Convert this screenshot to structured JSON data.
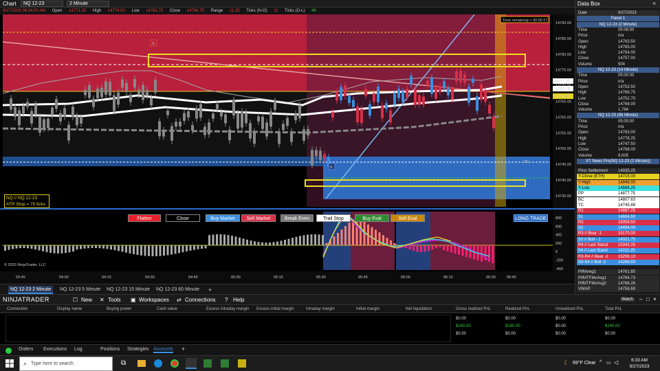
{
  "window": {
    "title": "Chart",
    "instrument": "NQ 12-23",
    "interval": "2 Minute"
  },
  "infobar": {
    "date": "9/27/2023 06:34:00 AM",
    "open_label": "Open",
    "open": "14771.25",
    "high_label": "High",
    "high": "14774.00",
    "low_label": "Low",
    "low": "14762.75",
    "close_label": "Close",
    "close": "14766.75",
    "range_label": "Range",
    "range": "11.25",
    "ticks_nd_label": "Ticks (N-O)",
    "ticks_nd": "11",
    "ticks_ol_label": "Ticks (O-L)",
    "ticks_ol": "46"
  },
  "chart_title": "NQ 12-23 (2 Minute), NQ 12-23 (14 Minute), NQ 12-23 (56 Minute)XT News Pro(NQ 12-23 (2 Minute))",
  "time_remaining": "Time remaining = 00:00:27",
  "price_axis": [
    "14790.00",
    "14785.00",
    "14780.00",
    "14775.00",
    "14770.00",
    "14765.00",
    "14760.00",
    "14755.00",
    "14750.00",
    "14745.00",
    "14740.00",
    "14735.00"
  ],
  "price_flags": [
    {
      "text": "14771.31"
    },
    {
      "text": "14768.78"
    },
    {
      "text": "14766.75"
    }
  ],
  "indicator_axis": [
    "800",
    "600",
    "400",
    "200",
    "0",
    "-200",
    "-400",
    "-600"
  ],
  "time_axis": [
    "03:45",
    "04:00",
    "04:15",
    "04:30",
    "04:45",
    "05:00",
    "05:15",
    "05:30",
    "05:45",
    "06:00",
    "06:15",
    "06:30",
    "06:45"
  ],
  "markers": {
    "s": "S",
    "b": "B",
    "tc": "TC"
  },
  "position_box": {
    "line1": "NQ // NQ 12-23",
    "line2": "ATR Stop = 70 ticks"
  },
  "copyright": "© 2023 NinjaTrader, LLC",
  "buttons": [
    {
      "label": "Flatten",
      "color": "#e8202a"
    },
    {
      "label": "Close",
      "color": "#000000"
    },
    {
      "label": "Buy Market",
      "color": "#3b8fe0"
    },
    {
      "label": "Sell Market",
      "color": "#d83048"
    },
    {
      "label": "Break Even",
      "color": "#777777"
    },
    {
      "label": "Trail Stop",
      "color": "#ffffff"
    },
    {
      "label": "Buy Eval",
      "color": "#2e8b2e"
    },
    {
      "label": "Sell Eval",
      "color": "#c8880a"
    }
  ],
  "long_trade": "LONG TRADE",
  "chart_tabs": [
    "NQ 12-23 2 Minute",
    "NQ 12-23 5 Minute",
    "NQ 12-23 15 Minute",
    "NQ 12-23 60 Minute",
    "+"
  ],
  "control_center": {
    "brand": "NINJATRADER",
    "menus": [
      "New",
      "Tools",
      "Workspaces",
      "Connections",
      "Help"
    ],
    "watch": "Watch"
  },
  "accounts": {
    "headers": [
      "Connection",
      "Display name",
      "Buying power",
      "Cash value",
      "Excess intraday margin",
      "Excess initial margin",
      "Intraday margin",
      "Initial margin",
      "Net liquidation",
      "Gross realized PnL",
      "Realized PnL",
      "Unrealized PnL",
      "Total PnL"
    ],
    "rows": [
      [
        "$0.00",
        "$0.00",
        "$0.00",
        "$0.00"
      ],
      [
        "$240.00",
        "$240.00",
        "$0.00",
        "$240.00"
      ],
      [
        "$0.00",
        "$0.00",
        "$0.00",
        "$0.00"
      ]
    ]
  },
  "bottom_tabs": [
    "Orders",
    "Executions",
    "Log",
    "Positions",
    "Strategies",
    "Accounts",
    "+"
  ],
  "taskbar": {
    "search": "Type here to search",
    "weather": "69°F  Clear",
    "time": "6:33 AM",
    "date": "9/27/2023"
  },
  "databox": {
    "title": "Data Box",
    "date_label": "Date",
    "date": "9/27/2023",
    "panel": "Panel 1",
    "sections": [
      {
        "header": "NQ 12-23 (2 Minute)",
        "rows": [
          [
            "Time",
            "05:06:00"
          ],
          [
            "Price",
            "n/a"
          ],
          [
            "Open",
            "14763.50"
          ],
          [
            "High",
            "14765.00"
          ],
          [
            "Low",
            "14754.00"
          ],
          [
            "Close",
            "14757.00"
          ],
          [
            "Volume",
            "504"
          ]
        ]
      },
      {
        "header": "NQ 12-23 (14 Minute)",
        "rows": [
          [
            "Time",
            "05:00:00"
          ],
          [
            "Price",
            "n/a"
          ],
          [
            "Open",
            "14753.50"
          ],
          [
            "High",
            "14769.75"
          ],
          [
            "Low",
            "14752.75"
          ],
          [
            "Close",
            "14768.00"
          ],
          [
            "Volume",
            "1,784"
          ]
        ]
      },
      {
        "header": "NQ 12-23 (56 Minute)",
        "rows": [
          [
            "Time",
            "05:00:00"
          ],
          [
            "Price",
            "n/a"
          ],
          [
            "Open",
            "14763.00"
          ],
          [
            "High",
            "14778.25"
          ],
          [
            "Low",
            "14747.50"
          ],
          [
            "Close",
            "14768.00"
          ],
          [
            "Volume",
            "9,005"
          ]
        ]
      }
    ],
    "xt_header": "XT News Pro(NQ 12-23 (2 Minute))",
    "levels": [
      [
        "Prior Settlement",
        "14935.25",
        "#2a2a2a",
        "#ddd"
      ],
      [
        "Y-Close (ETH)",
        "14715.00",
        "#e6d21e",
        "#000"
      ],
      [
        "Y-High",
        "14949.00",
        "#f0a030",
        "#000"
      ],
      [
        "Y-Low",
        "14666.25",
        "#40e0e0",
        "#000"
      ],
      [
        "PP",
        "14877.75",
        "#ffffff",
        "#000"
      ],
      [
        "BC",
        "14807.63",
        "#ffffff",
        "#000"
      ],
      [
        "TC",
        "14745.88",
        "#ffffff",
        "#000"
      ],
      [
        "R1",
        "14887.25",
        "#d83048",
        "#fff"
      ],
      [
        "S1",
        "14604.50",
        "#3b8fe0",
        "#fff"
      ],
      [
        "R2",
        "15059.50",
        "#d83048",
        "#fff"
      ],
      [
        "S2",
        "14494.00",
        "#3b8fe0",
        "#fff"
      ],
      [
        "R3 // Bear -1",
        "15170.00",
        "#d83048",
        "#fff"
      ],
      [
        "S3 // Bull - 1",
        "14321.75",
        "#3b8fe0",
        "#fff"
      ],
      [
        "R4 // Last Stand",
        "15342.25",
        "#d83048",
        "#fff"
      ],
      [
        "S4 // Last Stand",
        "14211.25",
        "#3b8fe0",
        "#fff"
      ],
      [
        "R3-R4 // Bear -2",
        "15256.13",
        "#d83048",
        "#fff"
      ],
      [
        "S3-S4 // Bull -2",
        "14266.50",
        "#3b8fe0",
        "#fff"
      ]
    ],
    "mtf": [
      [
        "PifMvwg1",
        "14761.85"
      ],
      [
        "PifMTFMvAvg1",
        "14764.73"
      ],
      [
        "PifMTFMvAvg2",
        "14766.26"
      ],
      [
        "VWAP",
        "14756.69"
      ]
    ]
  }
}
